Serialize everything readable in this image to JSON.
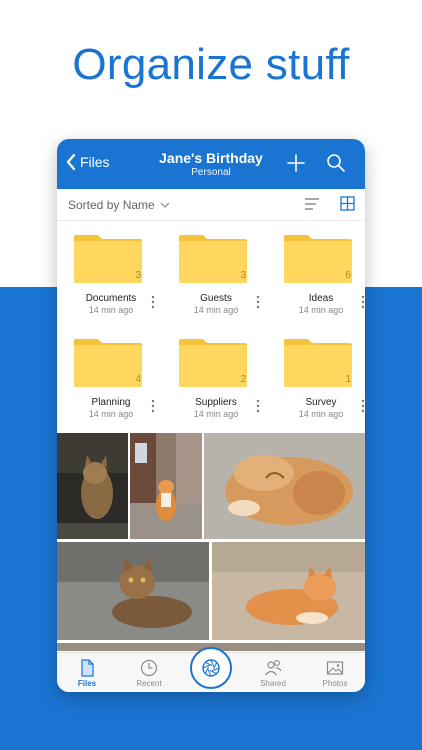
{
  "headline": "Organize stuff",
  "header": {
    "back_label": "Files",
    "title": "Jane's Birthday",
    "subtitle": "Personal",
    "accent": "#1a75d2"
  },
  "sortbar": {
    "label": "Sorted by Name"
  },
  "folders": [
    {
      "name": "Documents",
      "count": "3",
      "time": "14 min ago"
    },
    {
      "name": "Guests",
      "count": "3",
      "time": "14 min ago"
    },
    {
      "name": "Ideas",
      "count": "6",
      "time": "14 min ago"
    },
    {
      "name": "Planning",
      "count": "4",
      "time": "14 min ago"
    },
    {
      "name": "Suppliers",
      "count": "2",
      "time": "14 min ago"
    },
    {
      "name": "Survey",
      "count": "1",
      "time": "14 min ago"
    }
  ],
  "photos": [
    {
      "subject": "cat-looking-up"
    },
    {
      "subject": "cat-on-street"
    },
    {
      "subject": "cat-lying-on-back"
    },
    {
      "subject": "cat-crouching"
    },
    {
      "subject": "orange-cat-lying"
    }
  ],
  "tabs": [
    {
      "label": "Files",
      "icon": "file-icon",
      "active": true
    },
    {
      "label": "Recent",
      "icon": "clock-icon",
      "active": false
    },
    {
      "label": "Shared",
      "icon": "people-icon",
      "active": false
    },
    {
      "label": "Photos",
      "icon": "photo-icon",
      "active": false
    }
  ],
  "colors": {
    "brand_blue": "#1a75d2",
    "folder_yellow": "#ffd75e"
  }
}
